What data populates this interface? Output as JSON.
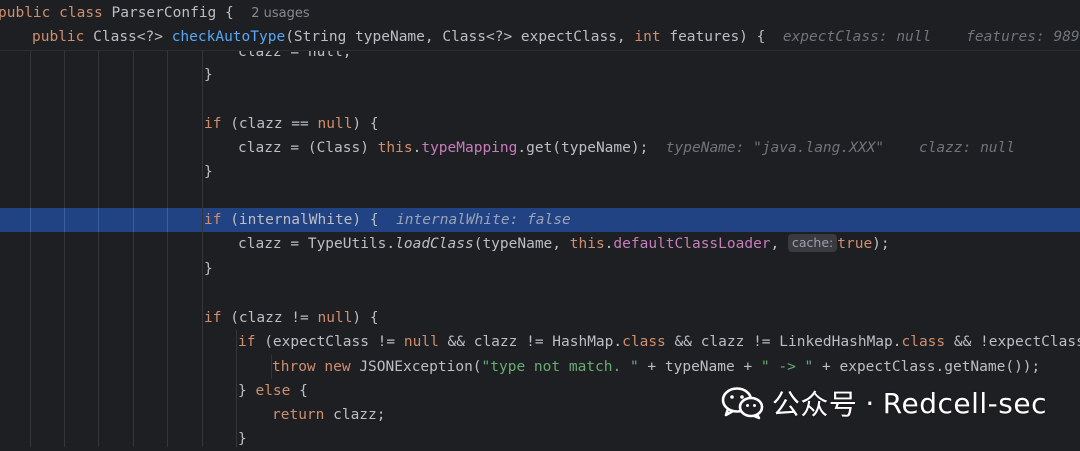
{
  "sticky": {
    "class_line": {
      "kw1": "public",
      "kw2": "class",
      "name": "ParserConfig {",
      "usages": "2 usages"
    },
    "method_line": {
      "kw": "public",
      "ret": "Class<?> ",
      "name": "checkAutoType",
      "params_a": "(String typeName, Class<?> expectClass, ",
      "kw_int": "int",
      "params_b": " features) {",
      "hint1": "expectClass: null",
      "hint2": "features: 989"
    }
  },
  "code": {
    "l1": {
      "text": "clazz = null;"
    },
    "l2": {
      "text": "}"
    },
    "l3": {
      "kw": "if",
      "a": " (clazz == ",
      "null": "null",
      "b": ") {"
    },
    "l4": {
      "a": "clazz = (Class) ",
      "this": "this",
      "dot": ".",
      "fld": "typeMapping",
      "b": ".get(typeName);",
      "hint1": "typeName: \"java.lang.XXX\"",
      "hint2": "clazz: null"
    },
    "l5": {
      "text": "}"
    },
    "l6": {
      "kw": "if",
      "a": " (internalWhite) {",
      "hint": "internalWhite: false"
    },
    "l7": {
      "a": "clazz = TypeUtils.",
      "method": "loadClass",
      "b": "(typeName, ",
      "this": "this",
      "dot": ".",
      "fld": "defaultClassLoader",
      "c": ", ",
      "chip": "cache:",
      "true": "true",
      "d": ");"
    },
    "l8": {
      "text": "}"
    },
    "l9": {
      "kw": "if",
      "a": " (clazz != ",
      "null": "null",
      "b": ") {"
    },
    "l10": {
      "kw": "if",
      "a": " (expectClass != ",
      "null": "null",
      "b": " && clazz != HashMap.",
      "cls1": "class",
      "c": " && clazz != LinkedHashMap.",
      "cls2": "class",
      "d": " && !expectClass.i"
    },
    "l11": {
      "kw1": "throw",
      "kw2": "new",
      "a": " JSONException(",
      "s1": "\"type not match. \"",
      "b": " + typeName + ",
      "s2": "\" -> \"",
      "c": " + expectClass.getName());"
    },
    "l12": {
      "a": "} ",
      "kw": "else",
      "b": " {"
    },
    "l13": {
      "kw": "return",
      "a": " clazz;"
    },
    "l14": {
      "text": "}"
    }
  },
  "watermark": {
    "icon": "wechat-icon",
    "text1": "公众号",
    "dot": "·",
    "text2": "Redcell-sec"
  },
  "colors": {
    "background": "#1e1f22",
    "highlight": "#214283",
    "keyword": "#cf8e6d",
    "function": "#56a8f5",
    "field": "#c77dbb",
    "string": "#6aab73",
    "hint": "#6f737a"
  }
}
